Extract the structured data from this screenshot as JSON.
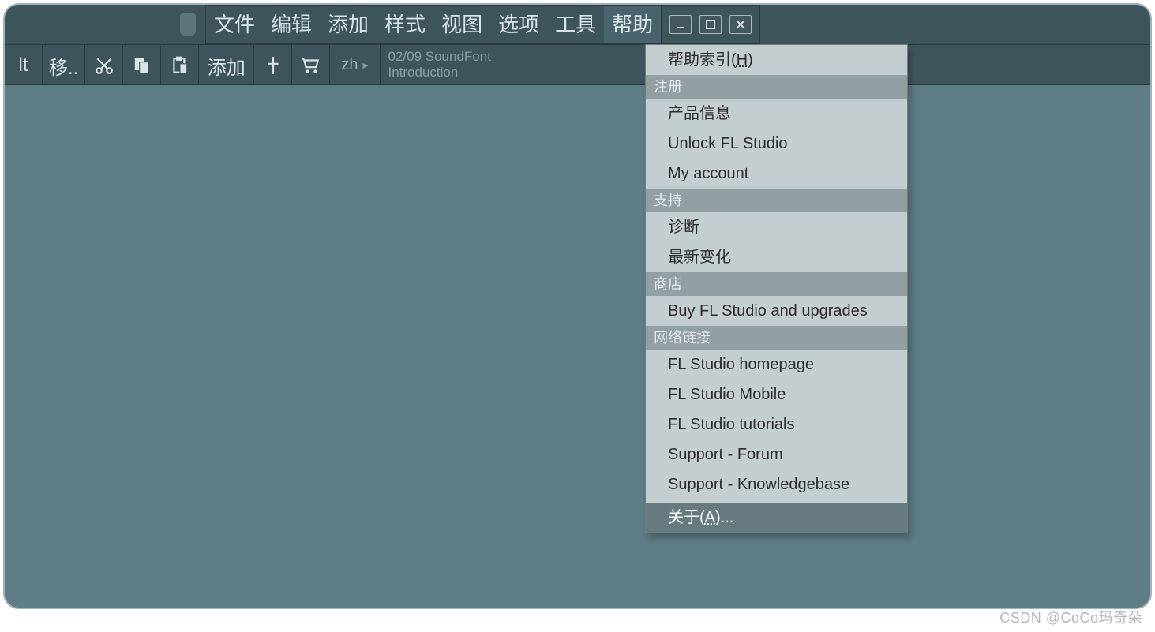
{
  "menubar": {
    "items": [
      "文件",
      "编辑",
      "添加",
      "样式",
      "视图",
      "选项",
      "工具",
      "帮助"
    ],
    "active_index": 7
  },
  "toolbar": {
    "buttons": [
      {
        "name": "tool-lt",
        "label": "lt"
      },
      {
        "name": "tool-move",
        "label": "移.."
      },
      {
        "name": "tool-cut",
        "label": ""
      },
      {
        "name": "tool-copy",
        "label": ""
      },
      {
        "name": "tool-paste",
        "label": ""
      },
      {
        "name": "tool-add",
        "label": "添加"
      },
      {
        "name": "tool-slice",
        "label": ""
      },
      {
        "name": "tool-cart",
        "label": ""
      }
    ],
    "lang": {
      "code": "zh",
      "arrow": "▸"
    },
    "hint": {
      "line1": "02/09  SoundFont",
      "line2": "Introduction"
    }
  },
  "help_menu": {
    "top_item": {
      "prefix": "帮助索引(",
      "u": "H",
      "suffix": ")"
    },
    "sections": [
      {
        "header": "注册",
        "items": [
          "产品信息",
          "Unlock FL Studio",
          "My account"
        ]
      },
      {
        "header": "支持",
        "items": [
          "诊断",
          "最新变化"
        ]
      },
      {
        "header": "商店",
        "items": [
          "Buy FL Studio and upgrades"
        ]
      },
      {
        "header": "网络链接",
        "items": [
          "FL Studio homepage",
          "FL Studio Mobile",
          "FL Studio tutorials",
          "Support - Forum",
          "Support - Knowledgebase"
        ]
      }
    ],
    "about": {
      "prefix": "关于(",
      "u": "A",
      "suffix": ")..."
    }
  },
  "watermark": "CSDN @CoCo玛奇朵"
}
